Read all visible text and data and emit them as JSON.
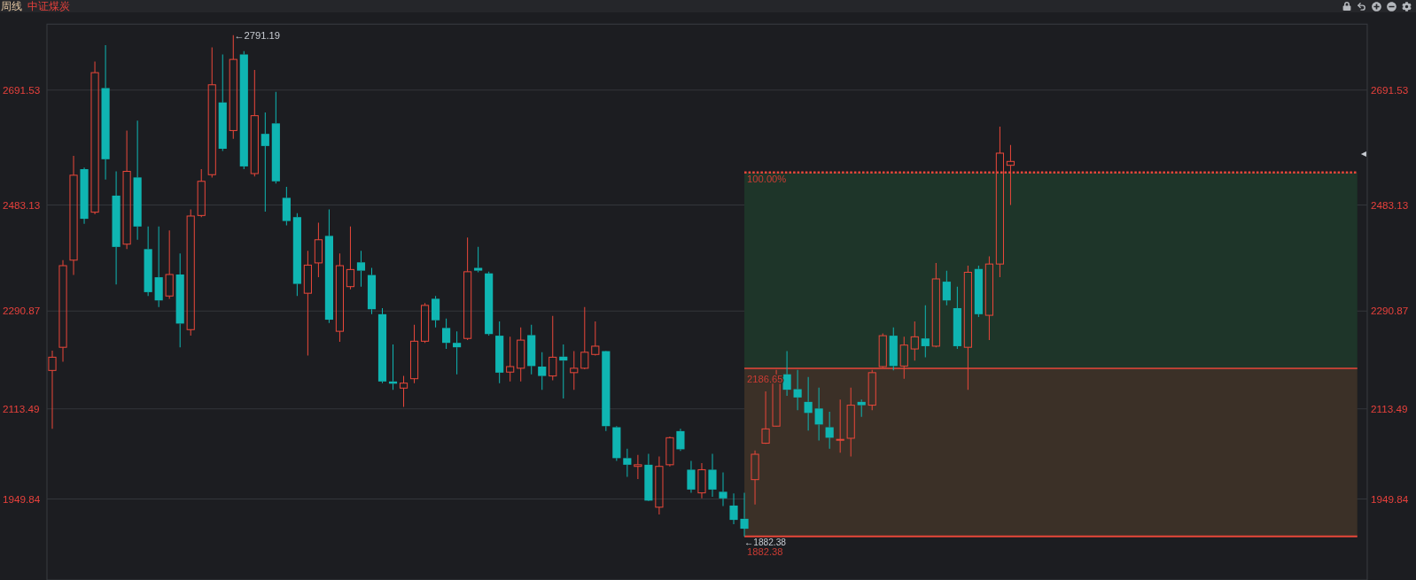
{
  "header": {
    "period": "周线",
    "title": "中证煤炭"
  },
  "chart": {
    "right_axis_labels": [
      "2691.53",
      "2483.13",
      "2290.87",
      "2113.49",
      "1949.84"
    ],
    "max_label": "←2791.19",
    "min_label": "←1882.38",
    "range_tool": {
      "top_label": "100.00%",
      "middle_label": "2186.65",
      "bottom_label": "1882.38"
    },
    "chart_data": {
      "type": "candlestick",
      "grid": true,
      "ylim": [
        1803,
        2811
      ],
      "yticks": [
        2691.53,
        2483.13,
        2290.87,
        2113.49,
        1949.84
      ],
      "categories": [
        null,
        null,
        null,
        null,
        null,
        null,
        null,
        null,
        null,
        null,
        null,
        null,
        null,
        null,
        null,
        null,
        null,
        null,
        null,
        null,
        null,
        null,
        null,
        null,
        null,
        null,
        null,
        null,
        null,
        null,
        null,
        null,
        null,
        null,
        null,
        null,
        null,
        null,
        null,
        null,
        null,
        null,
        null,
        null,
        null,
        null,
        null,
        null,
        null,
        null,
        null,
        null,
        null,
        null,
        null,
        null,
        null,
        null,
        null,
        null,
        null,
        null,
        null,
        null,
        null,
        null,
        null,
        null,
        null,
        null,
        null,
        null,
        null,
        null,
        null,
        null,
        null,
        null,
        null,
        null,
        null,
        null,
        null,
        null,
        null,
        null,
        null,
        null,
        null,
        null,
        null,
        null,
        null,
        null,
        null,
        null,
        null,
        null,
        null,
        null,
        null,
        null,
        null,
        null,
        null,
        null,
        null,
        null,
        null,
        null,
        null,
        null,
        null,
        null,
        null,
        null,
        null,
        null,
        null,
        null,
        null,
        null,
        null,
        null
      ],
      "ohlc": [
        [
          2183,
          2219,
          2077,
          2207
        ],
        [
          2225,
          2383,
          2199,
          2373
        ],
        [
          2383,
          2572,
          2356,
          2537
        ],
        [
          2548,
          2551,
          2449,
          2458
        ],
        [
          2470,
          2743,
          2466,
          2723
        ],
        [
          2695,
          2773,
          2529,
          2566
        ],
        [
          2500,
          2544,
          2339,
          2407
        ],
        [
          2412,
          2618,
          2403,
          2544
        ],
        [
          2533,
          2636,
          2420,
          2444
        ],
        [
          2403,
          2444,
          2318,
          2325
        ],
        [
          2352,
          2444,
          2298,
          2310
        ],
        [
          2318,
          2437,
          2313,
          2357
        ],
        [
          2357,
          2395,
          2225,
          2268
        ],
        [
          2257,
          2475,
          2246,
          2463
        ],
        [
          2464,
          2548,
          2461,
          2526
        ],
        [
          2538,
          2769,
          2533,
          2701
        ],
        [
          2669,
          2756,
          2581,
          2585
        ],
        [
          2618,
          2791,
          2603,
          2747
        ],
        [
          2756,
          2762,
          2548,
          2553
        ],
        [
          2540,
          2728,
          2535,
          2645
        ],
        [
          2612,
          2651,
          2471,
          2590
        ],
        [
          2631,
          2688,
          2522,
          2526
        ],
        [
          2496,
          2516,
          2446,
          2454
        ],
        [
          2461,
          2468,
          2318,
          2340
        ],
        [
          2323,
          2400,
          2210,
          2374
        ],
        [
          2378,
          2451,
          2352,
          2420
        ],
        [
          2427,
          2475,
          2269,
          2275
        ],
        [
          2254,
          2395,
          2235,
          2373
        ],
        [
          2335,
          2444,
          2330,
          2366
        ],
        [
          2379,
          2400,
          2335,
          2364
        ],
        [
          2356,
          2369,
          2285,
          2294
        ],
        [
          2285,
          2296,
          2160,
          2163
        ],
        [
          2163,
          2230,
          2148,
          2159
        ],
        [
          2151,
          2173,
          2117,
          2160
        ],
        [
          2168,
          2266,
          2160,
          2236
        ],
        [
          2236,
          2305,
          2233,
          2301
        ],
        [
          2313,
          2318,
          2261,
          2274
        ],
        [
          2260,
          2277,
          2222,
          2233
        ],
        [
          2233,
          2254,
          2176,
          2225
        ],
        [
          2241,
          2424,
          2238,
          2362
        ],
        [
          2369,
          2407,
          2361,
          2364
        ],
        [
          2359,
          2362,
          2246,
          2249
        ],
        [
          2246,
          2272,
          2160,
          2179
        ],
        [
          2180,
          2244,
          2163,
          2190
        ],
        [
          2187,
          2261,
          2163,
          2238
        ],
        [
          2247,
          2266,
          2176,
          2191
        ],
        [
          2190,
          2216,
          2148,
          2173
        ],
        [
          2173,
          2282,
          2165,
          2207
        ],
        [
          2208,
          2230,
          2132,
          2201
        ],
        [
          2179,
          2218,
          2148,
          2187
        ],
        [
          2187,
          2298,
          2185,
          2216
        ],
        [
          2212,
          2272,
          2210,
          2227
        ],
        [
          2218,
          2219,
          2073,
          2082
        ],
        [
          2080,
          2082,
          2019,
          2024
        ],
        [
          2024,
          2041,
          1990,
          2012
        ],
        [
          2009,
          2030,
          1986,
          2012
        ],
        [
          2012,
          2032,
          1946,
          1947
        ],
        [
          1935,
          2027,
          1922,
          2009
        ],
        [
          2012,
          2063,
          2009,
          2061
        ],
        [
          2073,
          2077,
          2037,
          2040
        ],
        [
          2003,
          2019,
          1961,
          1967
        ],
        [
          1961,
          2015,
          1951,
          2003
        ],
        [
          2003,
          2032,
          1954,
          1967
        ],
        [
          1963,
          1998,
          1937,
          1951
        ],
        [
          1938,
          1960,
          1904,
          1912
        ],
        [
          1914,
          1961,
          1882,
          1896
        ],
        [
          1985,
          2038,
          1940,
          2031
        ],
        [
          2051,
          2145,
          2050,
          2077
        ],
        [
          2082,
          2184,
          2081,
          2168
        ],
        [
          2176,
          2218,
          2137,
          2148
        ],
        [
          2149,
          2184,
          2111,
          2134
        ],
        [
          2126,
          2171,
          2074,
          2106
        ],
        [
          2114,
          2152,
          2056,
          2085
        ],
        [
          2080,
          2108,
          2041,
          2061
        ],
        [
          2057,
          2130,
          2034,
          2058
        ],
        [
          2060,
          2152,
          2027,
          2120
        ],
        [
          2126,
          2130,
          2099,
          2120
        ],
        [
          2120,
          2184,
          2111,
          2179
        ],
        [
          2190,
          2250,
          2188,
          2246
        ],
        [
          2246,
          2261,
          2183,
          2191
        ],
        [
          2191,
          2244,
          2168,
          2229
        ],
        [
          2222,
          2272,
          2201,
          2244
        ],
        [
          2241,
          2301,
          2207,
          2227
        ],
        [
          2227,
          2378,
          2225,
          2349
        ],
        [
          2344,
          2364,
          2301,
          2310
        ],
        [
          2296,
          2335,
          2222,
          2227
        ],
        [
          2225,
          2373,
          2148,
          2361
        ],
        [
          2367,
          2373,
          2280,
          2285
        ],
        [
          2283,
          2390,
          2238,
          2376
        ],
        [
          2376,
          2625,
          2352,
          2577
        ],
        [
          2555,
          2592,
          2483,
          2562
        ],
        null,
        null,
        null,
        null,
        null,
        null,
        null,
        null,
        null,
        null,
        null,
        null,
        null,
        null,
        null,
        null,
        null,
        null,
        null,
        null,
        null,
        null,
        null,
        null,
        null,
        null,
        null,
        null,
        null,
        null,
        null,
        null,
        null
      ]
    }
  }
}
